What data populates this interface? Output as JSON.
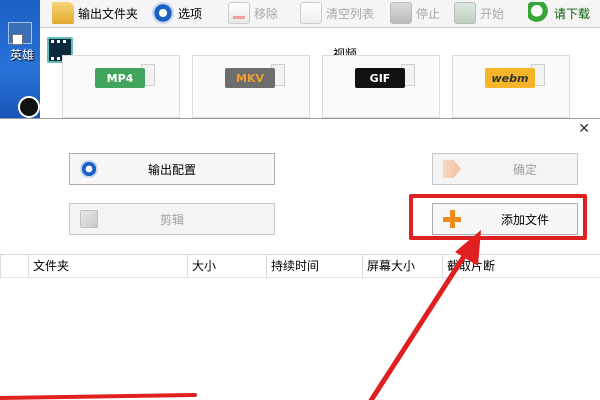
{
  "desktop": {
    "icon_label": "英雄"
  },
  "toolbar": {
    "output_folder": "输出文件夹",
    "options": "选项",
    "remove": "移除",
    "clear_list": "清空列表",
    "stop": "停止",
    "start": "开始",
    "download": "请下载"
  },
  "panel": {
    "title": "视频",
    "formats": [
      "MP4",
      "MKV",
      "GIF",
      "webm"
    ]
  },
  "dialog": {
    "output_config": "输出配置",
    "confirm": "确定",
    "clip": "剪辑",
    "add_file": "添加文件"
  },
  "table": {
    "columns": [
      "文件夹",
      "大小",
      "持续时间",
      "屏幕大小",
      "截取片断"
    ]
  },
  "colors": {
    "annotation": "#e02020",
    "accent": "#1a62c8",
    "add": "#f08c1a"
  }
}
